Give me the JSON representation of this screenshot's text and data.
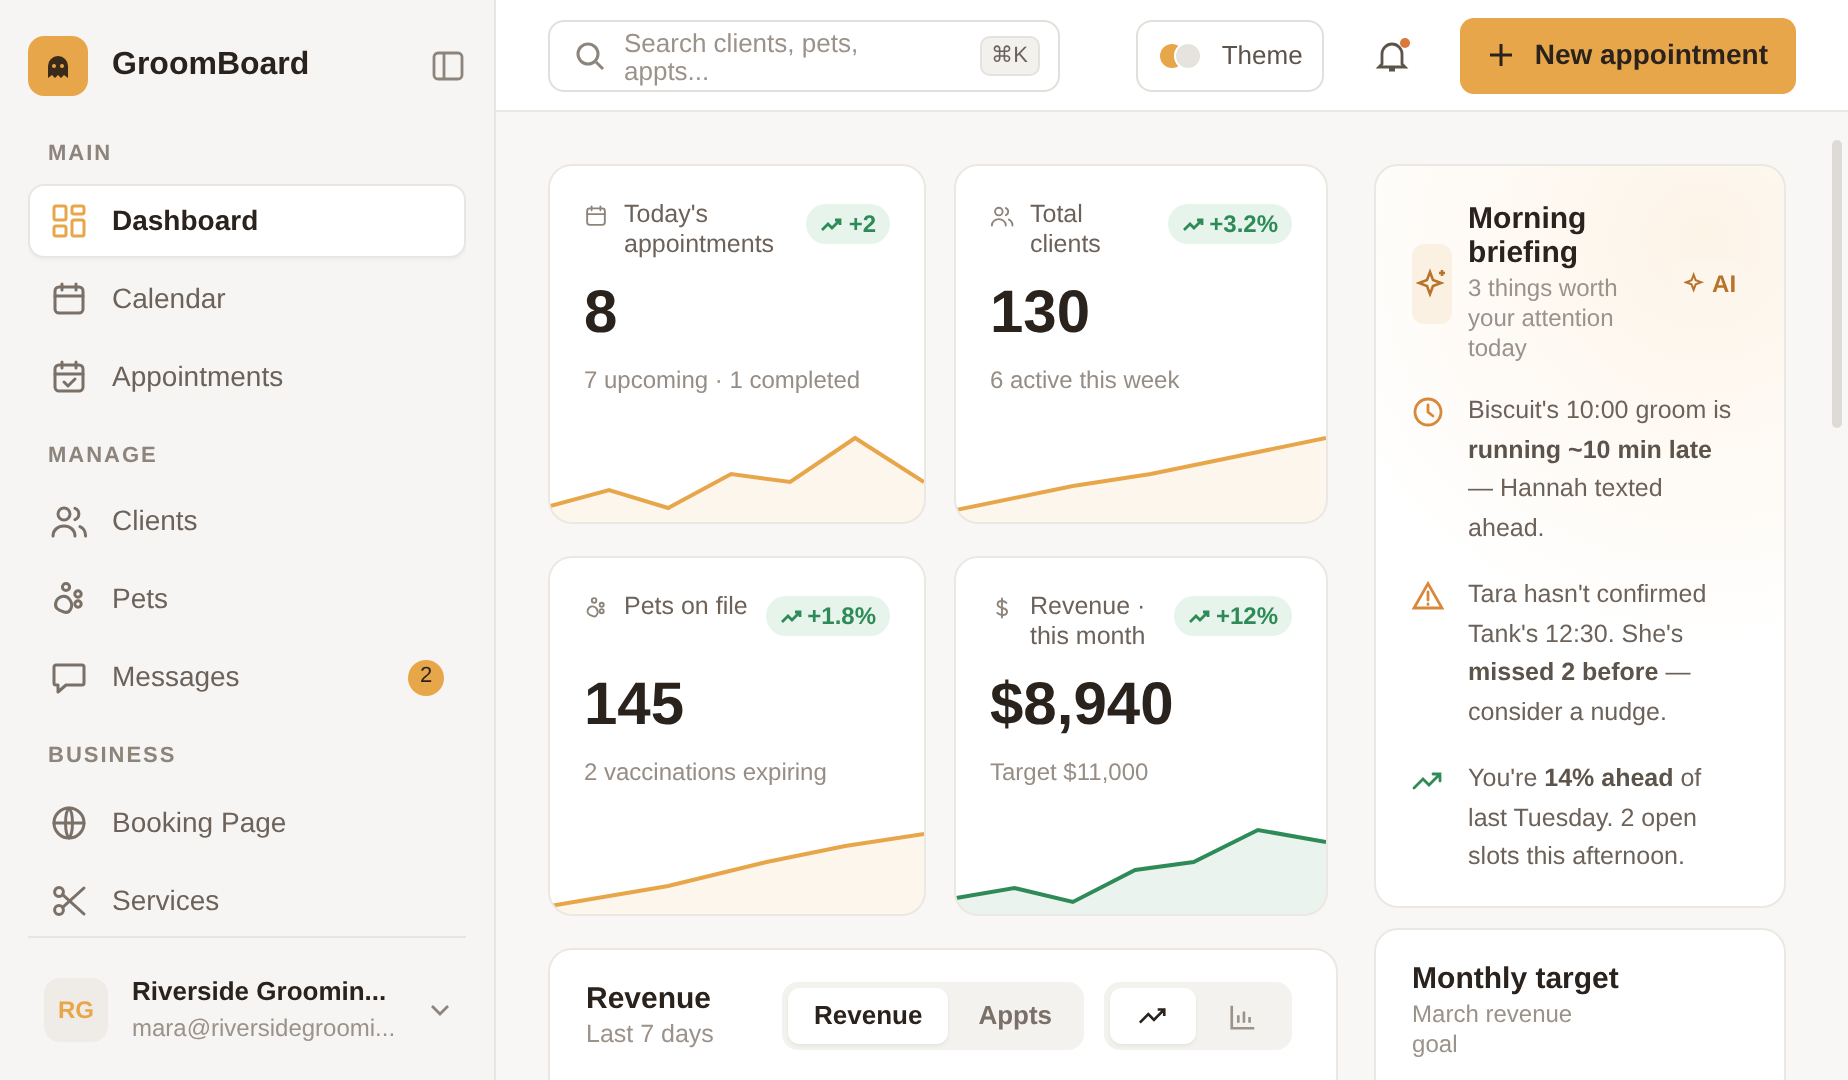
{
  "brand": {
    "name": "GroomBoard"
  },
  "nav": [
    {
      "label": "MAIN",
      "items": [
        {
          "label": "Dashboard",
          "selected": true
        },
        {
          "label": "Calendar",
          "selected": false
        },
        {
          "label": "Appointments",
          "selected": false
        }
      ]
    },
    {
      "label": "MANAGE",
      "items": [
        {
          "label": "Clients",
          "selected": false
        },
        {
          "label": "Pets",
          "selected": false
        },
        {
          "label": "Messages",
          "selected": false,
          "badge": "2"
        }
      ]
    },
    {
      "label": "BUSINESS",
      "items": [
        {
          "label": "Booking Page",
          "selected": false
        },
        {
          "label": "Services",
          "selected": false
        }
      ]
    }
  ],
  "account": {
    "initials": "RG",
    "name": "Riverside Groomin...",
    "email": "mara@riversidegroomi..."
  },
  "topbar": {
    "search": {
      "placeholder": "Search clients, pets, appts..."
    },
    "shortcut": "⌘K",
    "theme_label": "Theme",
    "notifications_unread": true,
    "new_button": "New appointment"
  },
  "stats": [
    {
      "label": "Today's appointments",
      "delta": "+2",
      "value": "8",
      "sub": "7 upcoming · 1 completed",
      "color": "#e8a64a"
    },
    {
      "label": "Total clients",
      "delta": "+3.2%",
      "value": "130",
      "sub": "6 active this week",
      "color": "#e8a64a"
    },
    {
      "label": "Pets on file",
      "delta": "+1.8%",
      "value": "145",
      "sub": "2 vaccinations expiring",
      "color": "#e8a64a"
    },
    {
      "label": "Revenue · this month",
      "delta": "+12%",
      "value": "$8,940",
      "sub": "Target $11,000",
      "color": "#2e8b57"
    }
  ],
  "briefing": {
    "title": "Morning briefing",
    "subtitle": "3 things worth your attention today",
    "badge": "AI",
    "items": [
      {
        "kind": "clock",
        "text": "Biscuit's 10:00 groom is **running ~10 min late** — Hannah texted ahead."
      },
      {
        "kind": "warning",
        "text": "Tara hasn't confirmed Tank's 12:30. She's **missed 2 before** — consider a nudge."
      },
      {
        "kind": "trend",
        "text": "You're **14% ahead** of last Tuesday. 2 open slots this afternoon."
      }
    ]
  },
  "revenue": {
    "title": "Revenue",
    "subtitle": "Last 7 days",
    "tabs": [
      {
        "label": "Revenue",
        "selected": true
      },
      {
        "label": "Appts",
        "selected": false
      }
    ],
    "chart_types": [
      {
        "kind": "line",
        "selected": true
      },
      {
        "kind": "bar",
        "selected": false
      }
    ]
  },
  "target": {
    "title": "Monthly target",
    "subtitle": "March revenue goal"
  }
}
